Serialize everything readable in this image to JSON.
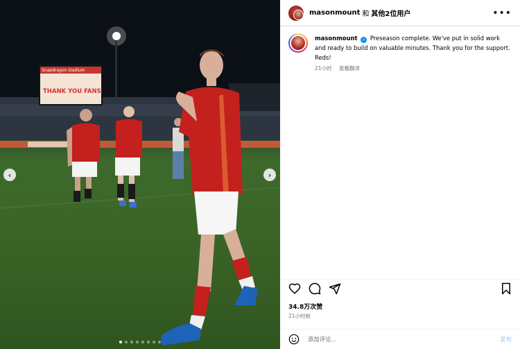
{
  "post": {
    "header": {
      "username": "masonmount",
      "and": "和",
      "others": "其他2位用户",
      "more_icon": "more-horizontal-icon"
    },
    "caption": {
      "username": "masonmount",
      "text": "Preseason complete. We've put in solid work and ready to build on valuable minutes. Thank you for the support. Reds!",
      "time": "21小时",
      "translate": "查看翻译"
    },
    "actions": {
      "like_icon": "heart-icon",
      "comment_icon": "comment-icon",
      "share_icon": "share-icon",
      "save_icon": "bookmark-icon"
    },
    "likes": "34.8万次赞",
    "timestamp": "21小时前",
    "comment": {
      "placeholder": "添加评论...",
      "post_label": "发布"
    }
  },
  "media": {
    "scoreboard_brand": "Snapdragon stadium",
    "scoreboard_text": "THANK YOU FANS",
    "shirt_sponsor": "Snapdragon",
    "carousel_count": 8,
    "carousel_active": 1
  }
}
